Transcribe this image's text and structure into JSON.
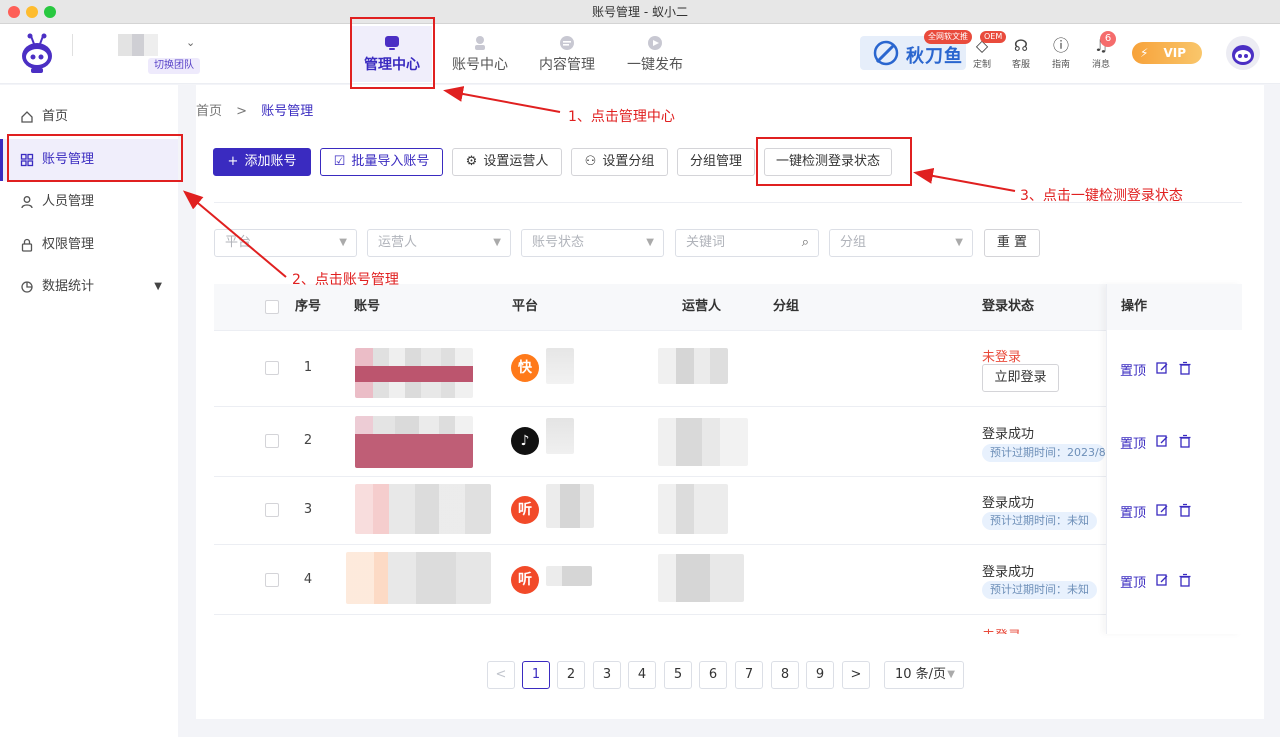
{
  "window": {
    "title": "账号管理 - 蚁小二"
  },
  "header": {
    "team_switch": "切换团队",
    "nav": [
      {
        "label": "管理中心",
        "icon": "monitor-icon",
        "active": true
      },
      {
        "label": "账号中心",
        "icon": "user-pin-icon",
        "active": false
      },
      {
        "label": "内容管理",
        "icon": "content-icon",
        "active": false
      },
      {
        "label": "一键发布",
        "icon": "publish-icon",
        "active": false
      }
    ],
    "promo": {
      "logo_text": "秋刀鱼",
      "badge": "全网软文推"
    },
    "icons": [
      {
        "label": "定制",
        "icon": "tag-icon",
        "badge": "OEM"
      },
      {
        "label": "客服",
        "icon": "headset-icon"
      },
      {
        "label": "指南",
        "icon": "help-icon"
      },
      {
        "label": "消息",
        "icon": "bell-icon",
        "badge": "6"
      }
    ],
    "vip": "VIP"
  },
  "sidebar": {
    "items": [
      {
        "label": "首页",
        "icon": "home-icon"
      },
      {
        "label": "账号管理",
        "icon": "grid-icon",
        "active": true
      },
      {
        "label": "人员管理",
        "icon": "person-icon"
      },
      {
        "label": "权限管理",
        "icon": "lock-icon"
      },
      {
        "label": "数据统计",
        "icon": "chart-icon",
        "expandable": true
      }
    ]
  },
  "breadcrumb": {
    "home": "首页",
    "sep": ">",
    "current": "账号管理"
  },
  "toolbar": {
    "add": "添加账号",
    "batch_import": "批量导入账号",
    "set_operator": "设置运营人",
    "set_group": "设置分组",
    "group_manage": "分组管理",
    "check_login": "一键检测登录状态"
  },
  "filters": {
    "platform": "平台",
    "operator": "运营人",
    "account_status": "账号状态",
    "keyword": "关键词",
    "group": "分组",
    "reset": "重 置"
  },
  "table": {
    "headers": {
      "index": "序号",
      "account": "账号",
      "platform": "平台",
      "operator": "运营人",
      "group": "分组",
      "login_status": "登录状态",
      "actions": "操作"
    },
    "rows": [
      {
        "index": "1",
        "platform_icon": "kuaishou-icon",
        "platform_glyph": "快",
        "platform_color": "#ff7a1a",
        "status": "未登录",
        "status_color": "#e94b3c",
        "login_button": "立即登录"
      },
      {
        "index": "2",
        "platform_icon": "douyin-icon",
        "platform_glyph": "♪",
        "platform_color": "#111111",
        "status": "登录成功",
        "expire": "预计过期时间：2023/8/"
      },
      {
        "index": "3",
        "platform_icon": "ximalaya-icon",
        "platform_glyph": "听",
        "platform_color": "#f24a29",
        "status": "登录成功",
        "expire": "预计过期时间：未知"
      },
      {
        "index": "4",
        "platform_icon": "ximalaya-icon",
        "platform_glyph": "听",
        "platform_color": "#f24a29",
        "status": "登录成功",
        "expire": "预计过期时间：未知"
      }
    ],
    "partial_status": "未登录",
    "action_pin": "置顶"
  },
  "pagination": {
    "prev": "<",
    "pages": [
      "1",
      "2",
      "3",
      "4",
      "5",
      "6",
      "7",
      "8",
      "9"
    ],
    "next": ">",
    "current": "1",
    "page_size": "10 条/页"
  },
  "annotations": {
    "step1": "1、点击管理中心",
    "step2": "2、点击账号管理",
    "step3": "3、点击一键检测登录状态"
  },
  "colors": {
    "accent": "#3a2bc0",
    "highlight": "#e02020",
    "danger": "#e94b3c"
  }
}
